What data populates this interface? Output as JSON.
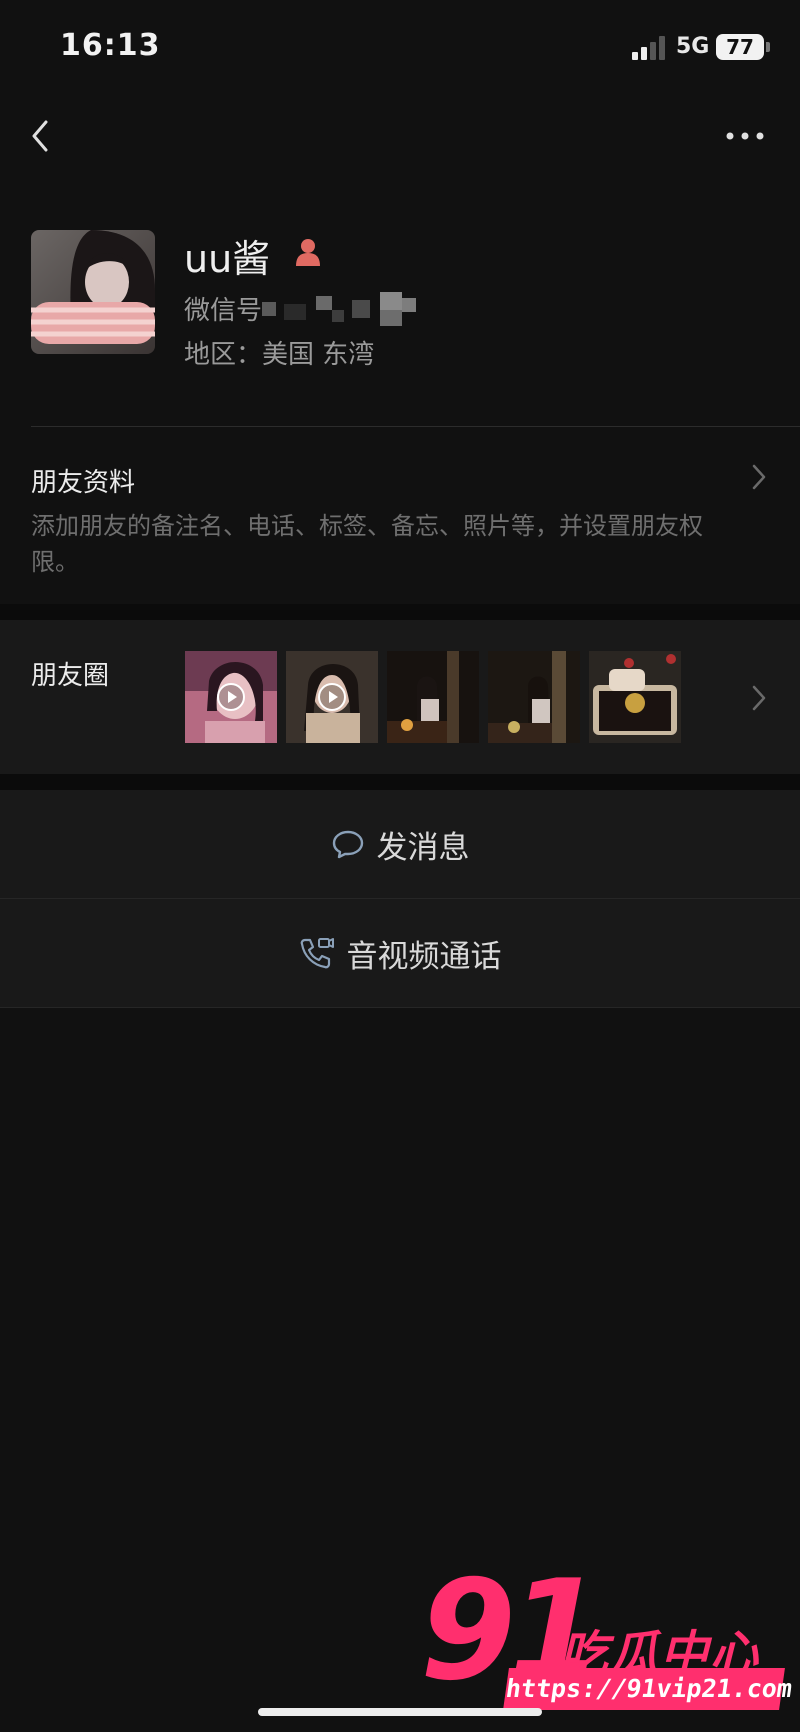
{
  "status_bar": {
    "time": "16:13",
    "network": "5G",
    "battery": "77"
  },
  "profile": {
    "nickname": "uu酱",
    "wechat_id_label": "微信号",
    "region_label": "地区：美国 东湾"
  },
  "friend_info": {
    "title": "朋友资料",
    "description": "添加朋友的备注名、电话、标签、备忘、照片等，并设置朋友权限。"
  },
  "moments": {
    "label": "朋友圈"
  },
  "actions": {
    "send_message": "发消息",
    "av_call": "音视频通话"
  },
  "watermark": {
    "number": "91",
    "name": "吃瓜中心",
    "url": "https://91vip21.com"
  },
  "colors": {
    "background": "#111111",
    "section": "#191919",
    "watermark": "#ff2f6e",
    "gender": "#e06a62"
  }
}
